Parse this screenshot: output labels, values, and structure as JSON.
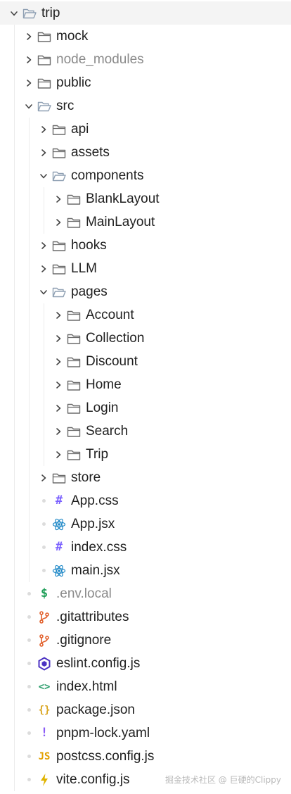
{
  "tree": {
    "items": [
      {
        "label": "trip",
        "depth": 0,
        "type": "folder",
        "open": true,
        "icon": "folder-open-icon"
      },
      {
        "label": "mock",
        "depth": 1,
        "type": "folder",
        "open": false,
        "icon": "folder-icon"
      },
      {
        "label": "node_modules",
        "depth": 1,
        "type": "folder",
        "open": false,
        "icon": "folder-icon",
        "muted": true
      },
      {
        "label": "public",
        "depth": 1,
        "type": "folder",
        "open": false,
        "icon": "folder-icon"
      },
      {
        "label": "src",
        "depth": 1,
        "type": "folder",
        "open": true,
        "icon": "folder-open-icon"
      },
      {
        "label": "api",
        "depth": 2,
        "type": "folder",
        "open": false,
        "icon": "folder-icon"
      },
      {
        "label": "assets",
        "depth": 2,
        "type": "folder",
        "open": false,
        "icon": "folder-icon"
      },
      {
        "label": "components",
        "depth": 2,
        "type": "folder",
        "open": true,
        "icon": "folder-open-icon"
      },
      {
        "label": "BlankLayout",
        "depth": 3,
        "type": "folder",
        "open": false,
        "icon": "folder-icon"
      },
      {
        "label": "MainLayout",
        "depth": 3,
        "type": "folder",
        "open": false,
        "icon": "folder-icon"
      },
      {
        "label": "hooks",
        "depth": 2,
        "type": "folder",
        "open": false,
        "icon": "folder-icon"
      },
      {
        "label": "LLM",
        "depth": 2,
        "type": "folder",
        "open": false,
        "icon": "folder-icon"
      },
      {
        "label": "pages",
        "depth": 2,
        "type": "folder",
        "open": true,
        "icon": "folder-open-icon"
      },
      {
        "label": "Account",
        "depth": 3,
        "type": "folder",
        "open": false,
        "icon": "folder-icon"
      },
      {
        "label": "Collection",
        "depth": 3,
        "type": "folder",
        "open": false,
        "icon": "folder-icon"
      },
      {
        "label": "Discount",
        "depth": 3,
        "type": "folder",
        "open": false,
        "icon": "folder-icon"
      },
      {
        "label": "Home",
        "depth": 3,
        "type": "folder",
        "open": false,
        "icon": "folder-icon"
      },
      {
        "label": "Login",
        "depth": 3,
        "type": "folder",
        "open": false,
        "icon": "folder-icon"
      },
      {
        "label": "Search",
        "depth": 3,
        "type": "folder",
        "open": false,
        "icon": "folder-icon"
      },
      {
        "label": "Trip",
        "depth": 3,
        "type": "folder",
        "open": false,
        "icon": "folder-icon"
      },
      {
        "label": "store",
        "depth": 2,
        "type": "folder",
        "open": false,
        "icon": "folder-icon"
      },
      {
        "label": "App.css",
        "depth": 2,
        "type": "file",
        "icon": "css-hash-icon"
      },
      {
        "label": "App.jsx",
        "depth": 2,
        "type": "file",
        "icon": "react-icon"
      },
      {
        "label": "index.css",
        "depth": 2,
        "type": "file",
        "icon": "css-hash-icon"
      },
      {
        "label": "main.jsx",
        "depth": 2,
        "type": "file",
        "icon": "react-icon"
      },
      {
        "label": ".env.local",
        "depth": 1,
        "type": "file",
        "icon": "env-dollar-icon",
        "muted": true
      },
      {
        "label": ".gitattributes",
        "depth": 1,
        "type": "file",
        "icon": "git-branch-icon"
      },
      {
        "label": ".gitignore",
        "depth": 1,
        "type": "file",
        "icon": "git-branch-icon"
      },
      {
        "label": "eslint.config.js",
        "depth": 1,
        "type": "file",
        "icon": "eslint-icon"
      },
      {
        "label": "index.html",
        "depth": 1,
        "type": "file",
        "icon": "html-code-icon"
      },
      {
        "label": "package.json",
        "depth": 1,
        "type": "file",
        "icon": "json-braces-icon"
      },
      {
        "label": "pnpm-lock.yaml",
        "depth": 1,
        "type": "file",
        "icon": "yaml-exclaim-icon"
      },
      {
        "label": "postcss.config.js",
        "depth": 1,
        "type": "file",
        "icon": "js-icon"
      },
      {
        "label": "vite.config.js",
        "depth": 1,
        "type": "file",
        "icon": "vite-icon"
      }
    ]
  },
  "icon_glyphs": {
    "css-hash-icon": "#",
    "env-dollar-icon": "$",
    "html-code-icon": "<>",
    "json-braces-icon": "{}",
    "yaml-exclaim-icon": "!",
    "js-icon": "JS"
  },
  "colors": {
    "folder": "#6b6b6b",
    "chevron": "#444444",
    "css": "#7b61ff",
    "react": "#1e88c7",
    "env": "#1f9e58",
    "git": "#e2612d",
    "eslint": "#4b32c3",
    "html": "#2e9f6e",
    "json": "#d9a520",
    "yaml": "#8b5cf6",
    "js": "#e2a000",
    "vite": "#e0b300"
  },
  "watermark": "掘金技术社区 @ 巨硬的Clippy"
}
